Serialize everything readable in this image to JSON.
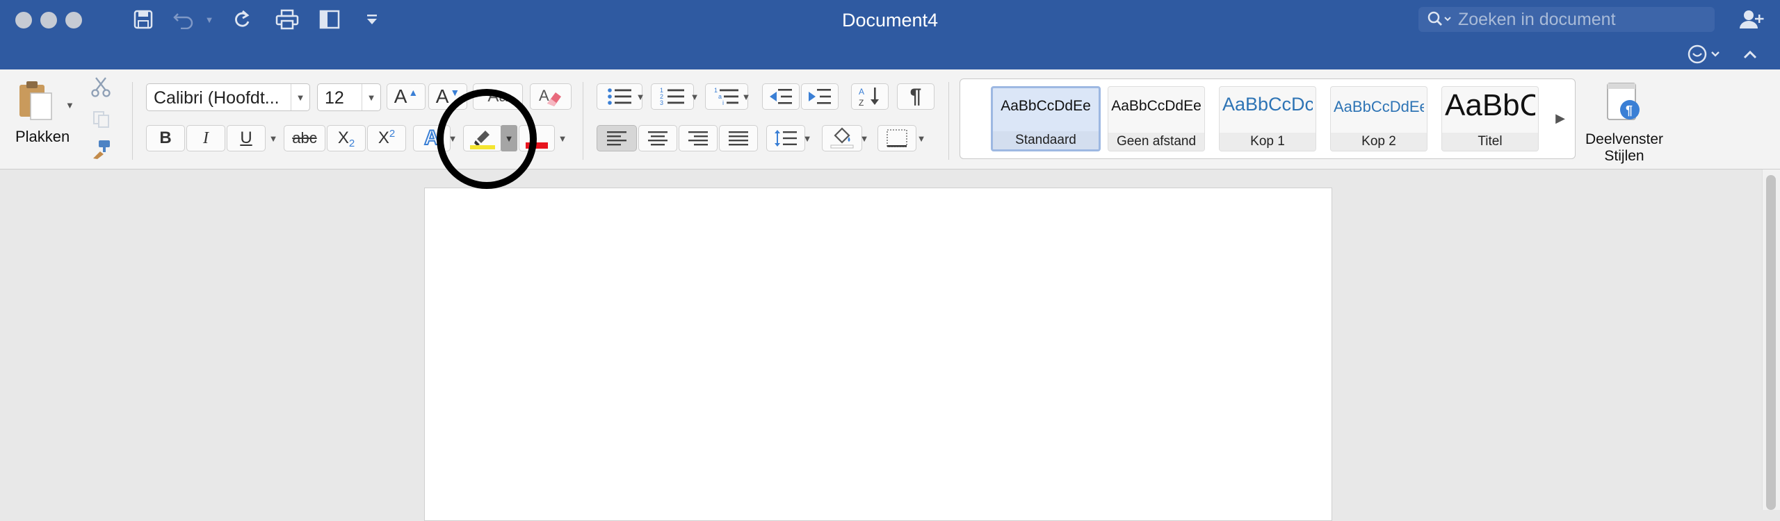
{
  "window": {
    "title": "Document4",
    "search_placeholder": "Zoeken in document"
  },
  "ribbon": {
    "paste_label": "Plakken",
    "font_name": "Calibri (Hoofdt...",
    "font_size": "12",
    "grow_font_glyph": "A",
    "shrink_font_glyph": "A",
    "change_case_glyph": "Aa",
    "bold_glyph": "B",
    "italic_glyph": "I",
    "underline_glyph": "U",
    "strikethrough_glyph": "abc",
    "subscript_glyph": "X",
    "subscript_mark": "2",
    "superscript_glyph": "X",
    "superscript_mark": "2",
    "text_effects_glyph": "A",
    "pilcrow_glyph": "¶",
    "styles": [
      {
        "preview": "AaBbCcDdEe",
        "label": "Standaard"
      },
      {
        "preview": "AaBbCcDdEe",
        "label": "Geen afstand"
      },
      {
        "preview": "AaBbCcDc",
        "label": "Kop 1"
      },
      {
        "preview": "AaBbCcDdEe",
        "label": "Kop 2"
      },
      {
        "preview": "AaBbC",
        "label": "Titel"
      }
    ],
    "styles_pane_label_1": "Deelvenster",
    "styles_pane_label_2": "Stijlen"
  },
  "colors": {
    "titlebar": "#2f5aa1",
    "highlight_yellow": "#f4e531",
    "font_color_red": "#e8141e",
    "accent_blue": "#3a7fd5"
  }
}
